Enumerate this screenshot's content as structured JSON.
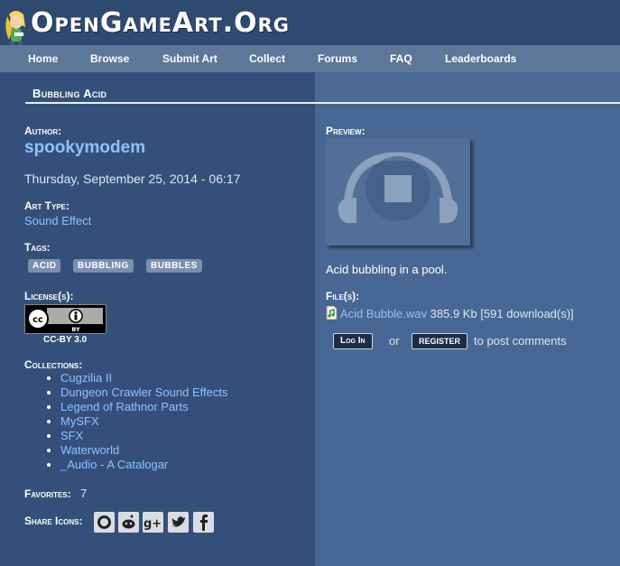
{
  "site": {
    "logo_text": "OpenGameArt.Org"
  },
  "nav": [
    {
      "label": "Home"
    },
    {
      "label": "Browse"
    },
    {
      "label": "Submit Art"
    },
    {
      "label": "Collect"
    },
    {
      "label": "Forums"
    },
    {
      "label": "FAQ"
    },
    {
      "label": "Leaderboards"
    }
  ],
  "page": {
    "title": "Bubbling Acid"
  },
  "author": {
    "label": "Author:",
    "name": "spookymodem",
    "date": "Thursday, September 25, 2014 - 06:17"
  },
  "art_type": {
    "label": "Art Type:",
    "value": "Sound Effect"
  },
  "tags": {
    "label": "Tags:",
    "items": [
      "Acid",
      "bubbling",
      "bubbles"
    ]
  },
  "license": {
    "label": "License(s):",
    "name": "CC-BY 3.0",
    "badge_text": "BY"
  },
  "collections": {
    "label": "Collections:",
    "items": [
      "Cugzilia II",
      "Dungeon Crawler Sound Effects",
      "Legend of Rathnor Parts",
      "MySFX",
      "SFX",
      "Waterworld",
      "_Audio - A Catalogar"
    ]
  },
  "favorites": {
    "label": "Favorites:",
    "value": "7"
  },
  "share": {
    "label": "Share Icons:",
    "icons": [
      "plus-one-icon",
      "reddit-icon",
      "google-plus-icon",
      "twitter-icon",
      "facebook-icon"
    ]
  },
  "preview": {
    "label": "Preview:",
    "icon": "headphones-stop-icon",
    "description": "Acid bubbling in a pool."
  },
  "files": {
    "label": "File(s):",
    "name": "Acid Bubble.wav",
    "size": "385.9 Kb",
    "downloads": "[591 download(s)]"
  },
  "comments": {
    "login_label": "Log in",
    "or_text": "or",
    "register_label": "register",
    "suffix": "to post comments"
  },
  "colors": {
    "link": "#8ec2ff",
    "nav_bg": "#5d7799",
    "left_bg": "#34507a",
    "right_bg": "#476894"
  }
}
